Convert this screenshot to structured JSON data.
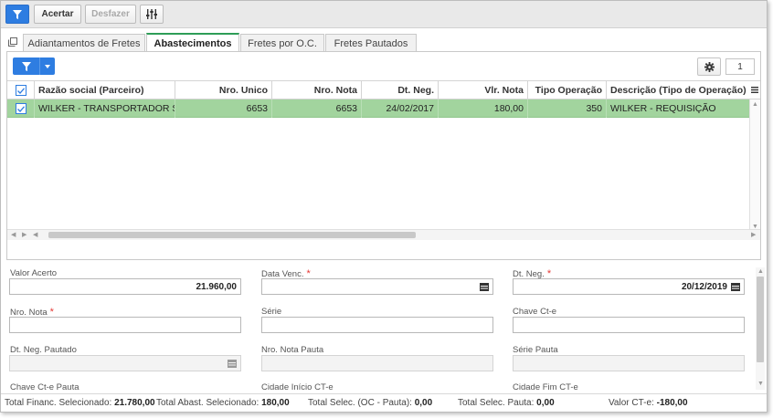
{
  "toolbar": {
    "filter_icon": "filter-icon",
    "acertar_label": "Acertar",
    "desfazer_label": "Desfazer",
    "settings_icon": "sliders-icon"
  },
  "tabs": [
    {
      "label": "Adiantamentos de Fretes",
      "active": false
    },
    {
      "label": "Abastecimentos",
      "active": true
    },
    {
      "label": "Fretes por O.C.",
      "active": false
    },
    {
      "label": "Fretes Pautados",
      "active": false
    }
  ],
  "grid": {
    "page_number": "1",
    "columns": {
      "razao": "Razão social (Parceiro)",
      "nro_unico": "Nro. Unico",
      "nro_nota": "Nro. Nota",
      "dt_neg": "Dt. Neg.",
      "vlr_nota": "Vlr. Nota",
      "tipo_operacao": "Tipo Operação",
      "descricao": "Descrição (Tipo de Operação)"
    },
    "rows": [
      {
        "razao": "WILKER - TRANSPORTADOR SFRA",
        "nro_unico": "6653",
        "nro_nota": "6653",
        "dt_neg": "24/02/2017",
        "vlr_nota": "180,00",
        "tipo_operacao": "350",
        "descricao": "WILKER - REQUISIÇÃO",
        "selected": true
      }
    ],
    "selected_color": "#a2d49e"
  },
  "form": {
    "valor_acerto_label": "Valor Acerto",
    "valor_acerto_value": "21.960,00",
    "data_venc_label": "Data Venc.",
    "data_venc_value": "",
    "dt_neg_label": "Dt. Neg.",
    "dt_neg_value": "20/12/2019",
    "nro_nota_label": "Nro. Nota",
    "nro_nota_value": "",
    "serie_label": "Série",
    "serie_value": "",
    "chave_cte_label": "Chave Ct-e",
    "chave_cte_value": "",
    "dt_neg_pautado_label": "Dt. Neg. Pautado",
    "nro_nota_pauta_label": "Nro. Nota Pauta",
    "serie_pauta_label": "Série Pauta",
    "chave_cte_pauta_label": "Chave Ct-e Pauta",
    "cidade_inicio_label": "Cidade Início CT-e",
    "cidade_fim_label": "Cidade Fim CT-e",
    "required_mark": "*"
  },
  "status": {
    "total_financ_label": "Total Financ. Selecionado:",
    "total_financ_value": "21.780,00",
    "total_abast_label": "Total Abast. Selecionado:",
    "total_abast_value": "180,00",
    "total_selec_oc_label": "Total Selec. (OC - Pauta):",
    "total_selec_oc_value": "0,00",
    "total_selec_pauta_label": "Total Selec. Pauta:",
    "total_selec_pauta_value": "0,00",
    "valor_cte_label": "Valor CT-e:",
    "valor_cte_value": "-180,00"
  }
}
